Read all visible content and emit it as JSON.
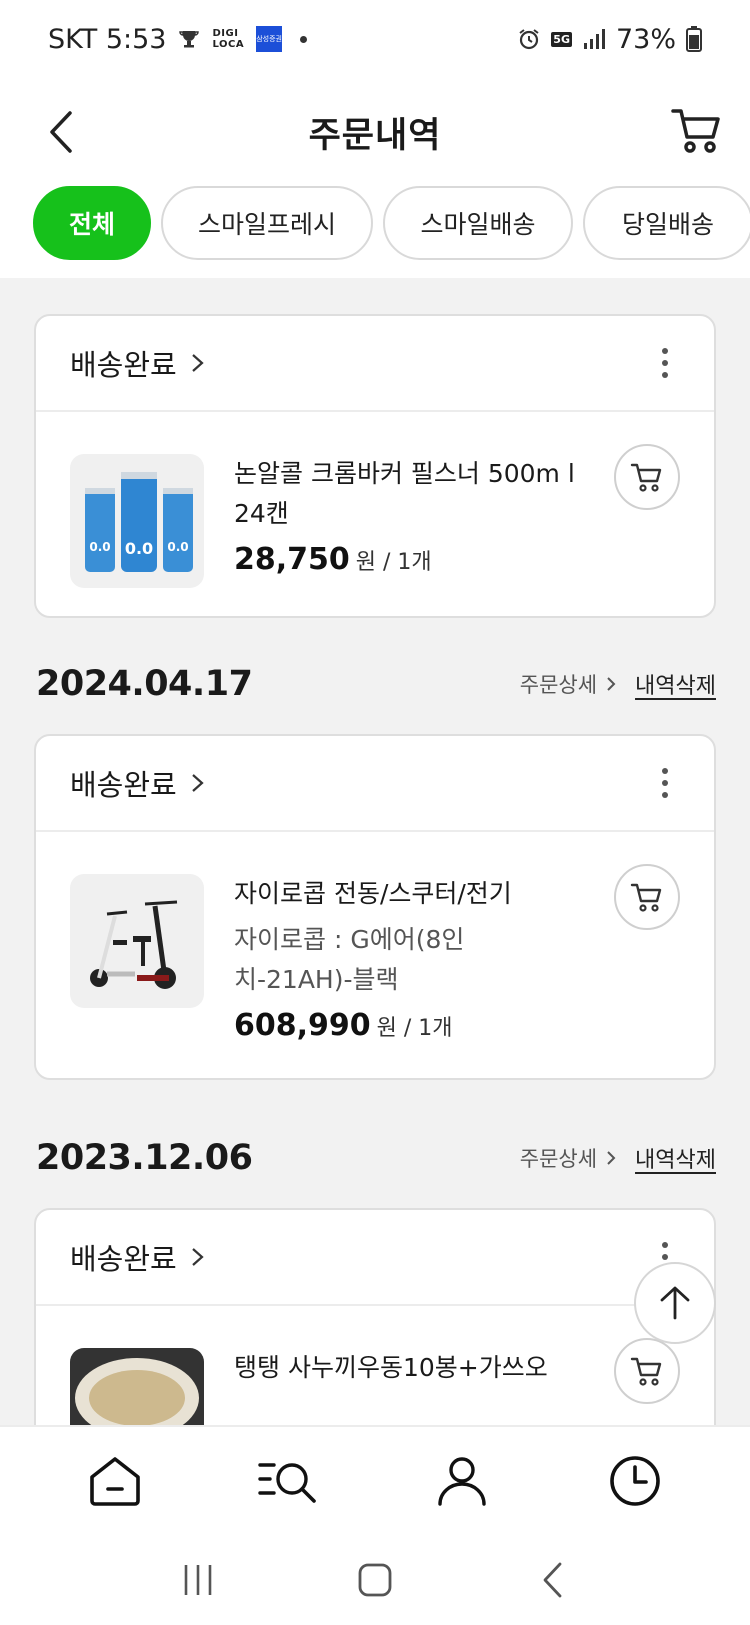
{
  "status_bar": {
    "carrier_time": "SKT 5:53",
    "digi_top": "DIGI",
    "digi_bottom": "LOCA",
    "samsung_badge": "삼성증권",
    "network": "5G",
    "battery": "73%"
  },
  "header": {
    "title": "주문내역",
    "back_icon": "chevron-left-icon",
    "cart_icon": "cart-icon"
  },
  "filters": [
    {
      "label": "전체",
      "active": true
    },
    {
      "label": "스마일프레시",
      "active": false
    },
    {
      "label": "스마일배송",
      "active": false
    },
    {
      "label": "당일배송",
      "active": false
    }
  ],
  "orders": [
    {
      "date": "",
      "status": "배송완료",
      "item": {
        "name": "논알콜 크롬바커 필스너 500m l 24캔",
        "option": "",
        "price": "28,750",
        "unit": "원 / 1개",
        "thumb_text": "0.0"
      }
    },
    {
      "date": "2024.04.17",
      "detail_label": "주문상세",
      "delete_label": "내역삭제",
      "status": "배송완료",
      "item": {
        "name": "자이로콥 전동/스쿠터/전기",
        "option": "자이로콥 : G에어(8인치-21AH)-블랙",
        "price": "608,990",
        "unit": "원 / 1개"
      }
    },
    {
      "date": "2023.12.06",
      "detail_label": "주문상세",
      "delete_label": "내역삭제",
      "status": "배송완료",
      "item": {
        "name": "탱탱 사누끼우동10봉+가쓰오",
        "option": "",
        "price": "",
        "unit": ""
      }
    }
  ],
  "bottom_nav": [
    "home-icon",
    "category-search-icon",
    "my-page-icon",
    "recent-history-icon"
  ],
  "colors": {
    "accent_green": "#16c11b",
    "background": "#f2f2f2",
    "card_border": "#dedede"
  }
}
